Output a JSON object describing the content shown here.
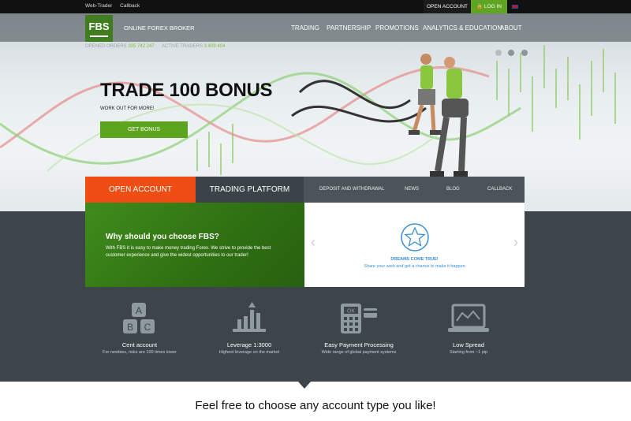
{
  "topbar": {
    "web_trader": "Web-Trader",
    "callback": "Callback",
    "open_account": "OPEN ACCOUNT",
    "login": "LOG IN"
  },
  "header": {
    "logo": "FBS",
    "brand_sub": "ONLINE FOREX BROKER",
    "nav": [
      "TRADING",
      "PARTNERSHIP",
      "PROMOTIONS",
      "ANALYTICS & EDUCATION",
      "ABOUT"
    ],
    "stats": {
      "opened_orders_label": "OPENED ORDERS",
      "opened_orders_value": "305 742 247",
      "active_traders_label": "ACTIVE TRADERS",
      "active_traders_value": "3 409 404"
    }
  },
  "hero": {
    "title": "TRADE 100 BONUS",
    "subtitle": "WORK OUT FOR MORE!",
    "button": "GET BONUS"
  },
  "tabs": {
    "open_account": "OPEN ACCOUNT",
    "trading_platform": "TRADING PLATFORM",
    "links": [
      "DEPOSIT AND WITHDRAWAL",
      "NEWS",
      "BLOG",
      "CALLBACK"
    ]
  },
  "why": {
    "heading": "Why should you choose FBS?",
    "text": "With FBS it is easy to make money trading Forex. We strive to provide the best customer experience and give the widest opportunities to our trader!"
  },
  "dreams": {
    "title": "DREAMS COME TRUE!",
    "text": "Share your wish and get a chance to make it happen"
  },
  "features": [
    {
      "icon": "abc-blocks-icon",
      "title": "Cent account",
      "sub": "For newbies, risks are 100 times lower"
    },
    {
      "icon": "leverage-chart-icon",
      "title": "Leverage 1:3000",
      "sub": "Highest leverage on the market"
    },
    {
      "icon": "payment-terminal-icon",
      "title": "Easy Payment Processing",
      "sub": "Wide range of global payment systems"
    },
    {
      "icon": "laptop-chart-icon",
      "title": "Low Spread",
      "sub": "Starting from ~1 pip"
    }
  ],
  "bottom": {
    "headline": "Feel free to choose any account type you like!"
  },
  "colors": {
    "brand_green": "#5fa521",
    "orange": "#ef4d14",
    "dark": "#3d454b"
  }
}
